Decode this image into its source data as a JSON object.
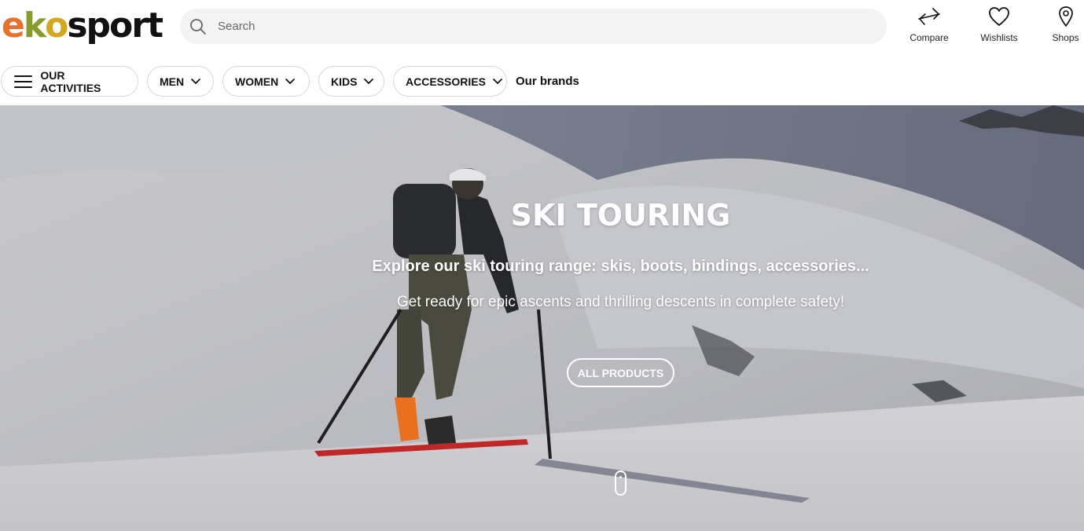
{
  "brand": {
    "logo_text": "ekosport",
    "logo_parts": [
      "e",
      "k",
      "o",
      "sport"
    ],
    "colors": [
      "#e8702a",
      "#8a9a2a",
      "#d4a81c",
      "#111111"
    ]
  },
  "search": {
    "placeholder": "Search",
    "value": ""
  },
  "header_actions": {
    "compare": {
      "label": "Compare",
      "icon": "compare-arrows-icon"
    },
    "wishlists": {
      "label": "Wishlists",
      "icon": "heart-icon"
    },
    "shops": {
      "label": "Shops",
      "icon": "map-pin-icon"
    }
  },
  "nav": {
    "activities": {
      "label": "OUR ACTIVITIES",
      "icon": "hamburger-menu-icon"
    },
    "men": {
      "label": "MEN",
      "icon": "chevron-down-icon"
    },
    "women": {
      "label": "WOMEN",
      "icon": "chevron-down-icon"
    },
    "kids": {
      "label": "KIDS",
      "icon": "chevron-down-icon"
    },
    "accessories": {
      "label": "ACCESSORIES",
      "icon": "chevron-down-icon"
    },
    "brands": {
      "label": "Our brands"
    }
  },
  "hero": {
    "title": "SKI TOURING",
    "subtitle": "Explore our ski touring range: skis, boots, bindings, accessories...",
    "tagline": "Get ready for epic ascents and thrilling descents in complete safety!",
    "cta_label": "ALL PRODUCTS",
    "scroll_icon": "mouse-scroll-icon",
    "image": "skier-on-snowy-slope"
  }
}
